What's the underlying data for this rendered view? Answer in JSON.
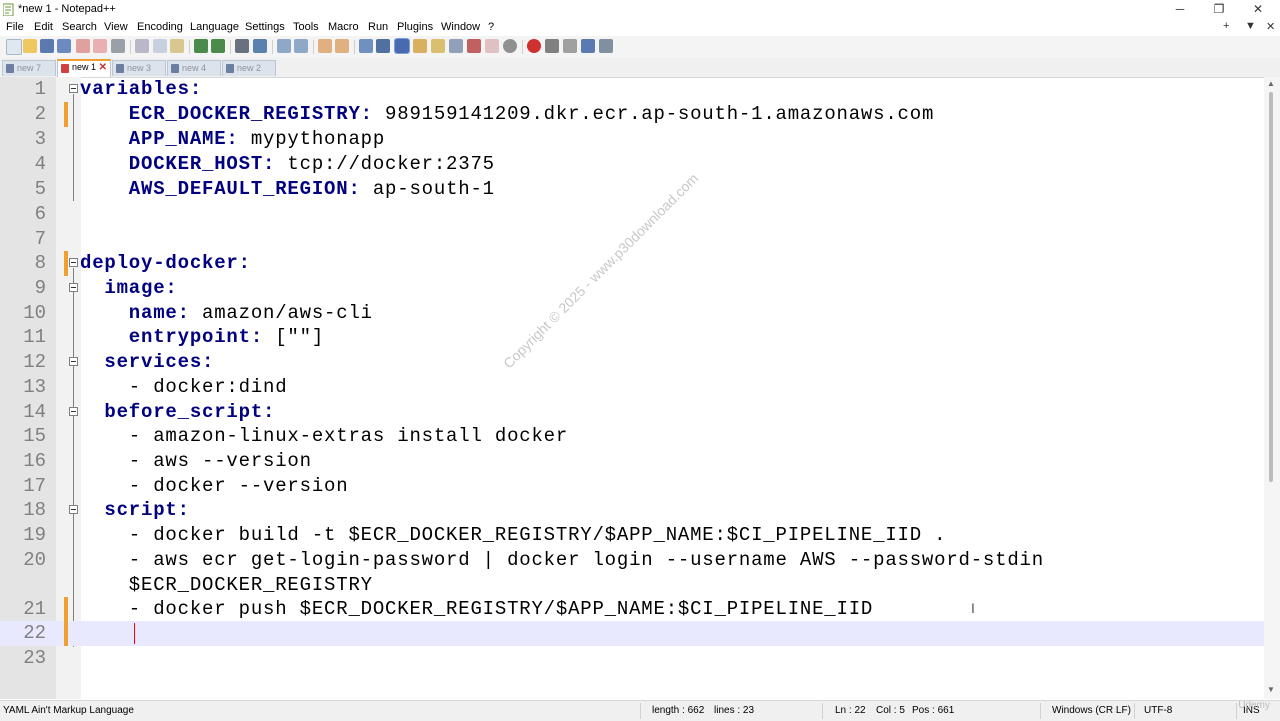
{
  "window": {
    "title": "*new 1 - Notepad++",
    "minimize": "─",
    "restore": "❐",
    "close": "✕"
  },
  "menu": {
    "items": [
      "File",
      "Edit",
      "Search",
      "View",
      "Encoding",
      "Language",
      "Settings",
      "Tools",
      "Macro",
      "Run",
      "Plugins",
      "Window",
      "?"
    ],
    "right": [
      "+",
      "▼",
      "✕"
    ]
  },
  "toolbar": {
    "buttons": [
      "new-file-icon",
      "open-file-icon",
      "save-icon",
      "save-all-icon",
      "close-icon",
      "close-all-icon",
      "print-icon",
      "cut-icon",
      "copy-icon",
      "paste-icon",
      "undo-icon",
      "redo-icon",
      "find-icon",
      "replace-icon",
      "zoom-in-icon",
      "zoom-out-icon",
      "sync-v-icon",
      "sync-h-icon",
      "wrap-icon",
      "all-chars-icon",
      "indent-guide-icon",
      "udl-icon",
      "doc-map-icon",
      "function-list-icon",
      "folder-workspace-icon",
      "monitor-icon",
      "record-macro-icon",
      "stop-macro-icon",
      "play-macro-icon",
      "run-macro-multiple-icon",
      "save-macro-icon"
    ]
  },
  "tabs": [
    {
      "label": "new 7",
      "active": false
    },
    {
      "label": "new 1",
      "active": true
    },
    {
      "label": "new 3",
      "active": false
    },
    {
      "label": "new 4",
      "active": false
    },
    {
      "label": "new 2",
      "active": false
    }
  ],
  "editor": {
    "lines": [
      {
        "num": "1",
        "key": "variables:",
        "val": ""
      },
      {
        "num": "2",
        "key": "    ECR_DOCKER_REGISTRY:",
        "val": " 989159141209.dkr.ecr.ap-south-1.amazonaws.com"
      },
      {
        "num": "3",
        "key": "    APP_NAME:",
        "val": " mypythonapp"
      },
      {
        "num": "4",
        "key": "    DOCKER_HOST:",
        "val": " tcp://docker:2375"
      },
      {
        "num": "5",
        "key": "    AWS_DEFAULT_REGION:",
        "val": " ap-south-1"
      },
      {
        "num": "6",
        "key": "",
        "val": ""
      },
      {
        "num": "7",
        "key": "",
        "val": ""
      },
      {
        "num": "8",
        "key": "deploy-docker:",
        "val": ""
      },
      {
        "num": "9",
        "key": "  image:",
        "val": ""
      },
      {
        "num": "10",
        "key": "    name:",
        "val": " amazon/aws-cli"
      },
      {
        "num": "11",
        "key": "    entrypoint:",
        "val": " [\"\"]"
      },
      {
        "num": "12",
        "key": "  services:",
        "val": ""
      },
      {
        "num": "13",
        "key": "",
        "val": "    - docker:dind"
      },
      {
        "num": "14",
        "key": "  before_script:",
        "val": ""
      },
      {
        "num": "15",
        "key": "",
        "val": "    - amazon-linux-extras install docker"
      },
      {
        "num": "16",
        "key": "",
        "val": "    - aws --version"
      },
      {
        "num": "17",
        "key": "",
        "val": "    - docker --version"
      },
      {
        "num": "18",
        "key": "  script:",
        "val": ""
      },
      {
        "num": "19",
        "key": "",
        "val": "    - docker build -t $ECR_DOCKER_REGISTRY/$APP_NAME:$CI_PIPELINE_IID ."
      },
      {
        "num": "20",
        "key": "",
        "val": "    - aws ecr get-login-password | docker login --username AWS --password-stdin"
      },
      {
        "num": "",
        "key": "",
        "val": "    $ECR_DOCKER_REGISTRY"
      },
      {
        "num": "21",
        "key": "",
        "val": "    - docker push $ECR_DOCKER_REGISTRY/$APP_NAME:$CI_PIPELINE_IID"
      },
      {
        "num": "22",
        "key": "",
        "val": ""
      },
      {
        "num": "23",
        "key": "",
        "val": ""
      }
    ],
    "watermark": "Copyright © 2025 - www.p30download.com",
    "ibeam": "I"
  },
  "status": {
    "language": "YAML Ain't Markup Language",
    "length": "length : 662",
    "lines": "lines : 23",
    "ln": "Ln : 22",
    "col": "Col : 5",
    "pos": "Pos : 661",
    "eol": "Windows (CR LF)",
    "encoding": "UTF-8",
    "mode": "INS",
    "logo": "Udemy"
  },
  "colors": {
    "keyword": "#000080",
    "current_line": "#e8e8ff",
    "change_marker": "#f0a030"
  }
}
